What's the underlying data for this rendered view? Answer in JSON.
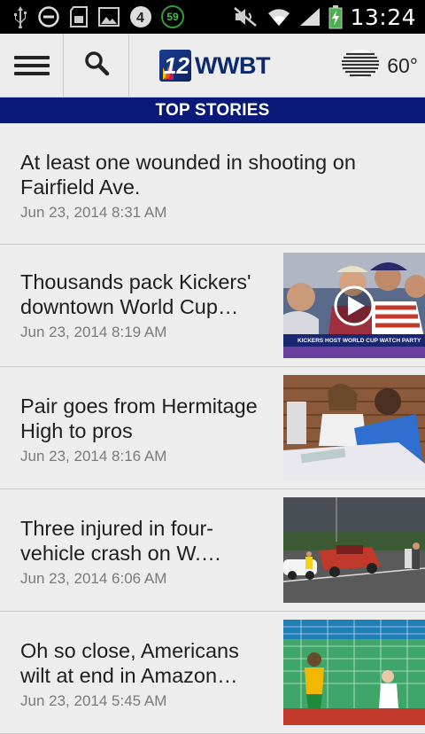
{
  "status_bar": {
    "time": "13:24",
    "badge": "59",
    "icons": [
      "usb-icon",
      "do-not-disturb-icon",
      "sd-card-icon",
      "image-icon",
      "nbc4-icon",
      "badge-59-icon",
      "mute-icon",
      "wifi-icon",
      "signal-icon",
      "battery-charging-icon"
    ]
  },
  "app_bar": {
    "menu_icon": "hamburger-icon",
    "search_icon": "search-icon",
    "logo_number": "12",
    "logo_call_sign": "WWBT",
    "weather_icon": "fog-icon",
    "temperature": "60°"
  },
  "section": {
    "title": "TOP STORIES"
  },
  "stories": [
    {
      "headline": "At least one wounded in shooting on Fairfield Ave.",
      "date": "Jun 23, 2014 8:31 AM",
      "has_image": false
    },
    {
      "headline": "Thousands pack Kickers' downtown World Cup…",
      "date": "Jun 23, 2014 8:19 AM",
      "has_image": true,
      "has_video": true,
      "image_caption": "KICKERS HOST WORLD CUP WATCH PARTY"
    },
    {
      "headline": "Pair goes from Hermitage High to pros",
      "date": "Jun 23, 2014 8:16 AM",
      "has_image": true
    },
    {
      "headline": "Three injured in four-vehicle crash on W.…",
      "date": "Jun 23, 2014 6:06 AM",
      "has_image": true
    },
    {
      "headline": "Oh so close, Americans wilt at end in Amazon…",
      "date": "Jun 23, 2014 5:45 AM",
      "has_image": true
    }
  ],
  "colors": {
    "section_bar": "#0a1a78",
    "logo_blue": "#0d2a6b",
    "badge_green": "#3fbf45",
    "battery_green": "#4caf50"
  }
}
